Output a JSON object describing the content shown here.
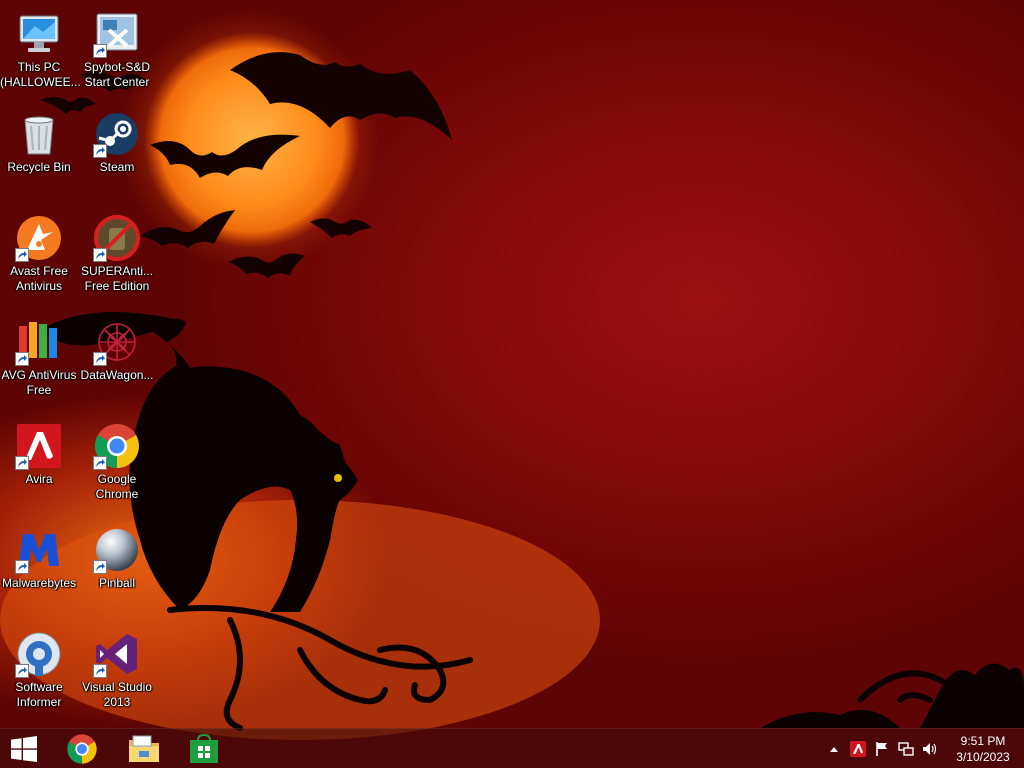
{
  "desktop": {
    "icons": [
      {
        "name": "this-pc",
        "label": "This PC (HALLOWEE...",
        "icon": "this-pc-icon",
        "shortcut": false
      },
      {
        "name": "spybot",
        "label": "Spybot-S&D Start Center",
        "icon": "spybot-icon",
        "shortcut": true
      },
      {
        "name": "recycle-bin",
        "label": "Recycle Bin",
        "icon": "recycle-bin-icon",
        "shortcut": false
      },
      {
        "name": "steam",
        "label": "Steam",
        "icon": "steam-icon",
        "shortcut": true
      },
      {
        "name": "avast",
        "label": "Avast Free Antivirus",
        "icon": "avast-icon",
        "shortcut": true
      },
      {
        "name": "superantispyware",
        "label": "SUPERAnti... Free Edition",
        "icon": "superantispyware-icon",
        "shortcut": true
      },
      {
        "name": "avg",
        "label": "AVG AntiVirus Free",
        "icon": "avg-icon",
        "shortcut": true
      },
      {
        "name": "datawagon",
        "label": "DataWagon...",
        "icon": "datawagon-icon",
        "shortcut": true
      },
      {
        "name": "avira",
        "label": "Avira",
        "icon": "avira-icon",
        "shortcut": true
      },
      {
        "name": "google-chrome",
        "label": "Google Chrome",
        "icon": "chrome-icon",
        "shortcut": true
      },
      {
        "name": "malwarebytes",
        "label": "Malwarebytes",
        "icon": "malwarebytes-icon",
        "shortcut": true
      },
      {
        "name": "pinball",
        "label": "Pinball",
        "icon": "pinball-icon",
        "shortcut": true
      },
      {
        "name": "software-informer",
        "label": "Software Informer",
        "icon": "software-informer-icon",
        "shortcut": true
      },
      {
        "name": "visual-studio-2013",
        "label": "Visual Studio 2013",
        "icon": "visual-studio-icon",
        "shortcut": true
      }
    ]
  },
  "taskbar": {
    "pinned": [
      {
        "name": "start-button",
        "icon": "windows-logo-icon"
      },
      {
        "name": "taskbar-chrome",
        "icon": "chrome-icon"
      },
      {
        "name": "taskbar-file-explorer",
        "icon": "file-explorer-icon"
      },
      {
        "name": "taskbar-store",
        "icon": "store-icon"
      }
    ],
    "tray": [
      {
        "name": "show-hidden-icons",
        "icon": "chevron-up-icon"
      },
      {
        "name": "tray-avira",
        "icon": "avira-icon"
      },
      {
        "name": "tray-action-center",
        "icon": "flag-icon"
      },
      {
        "name": "tray-network",
        "icon": "network-icon"
      },
      {
        "name": "tray-volume",
        "icon": "speaker-icon"
      }
    ],
    "clock": {
      "time": "9:51 PM",
      "date": "3/10/2023"
    }
  }
}
